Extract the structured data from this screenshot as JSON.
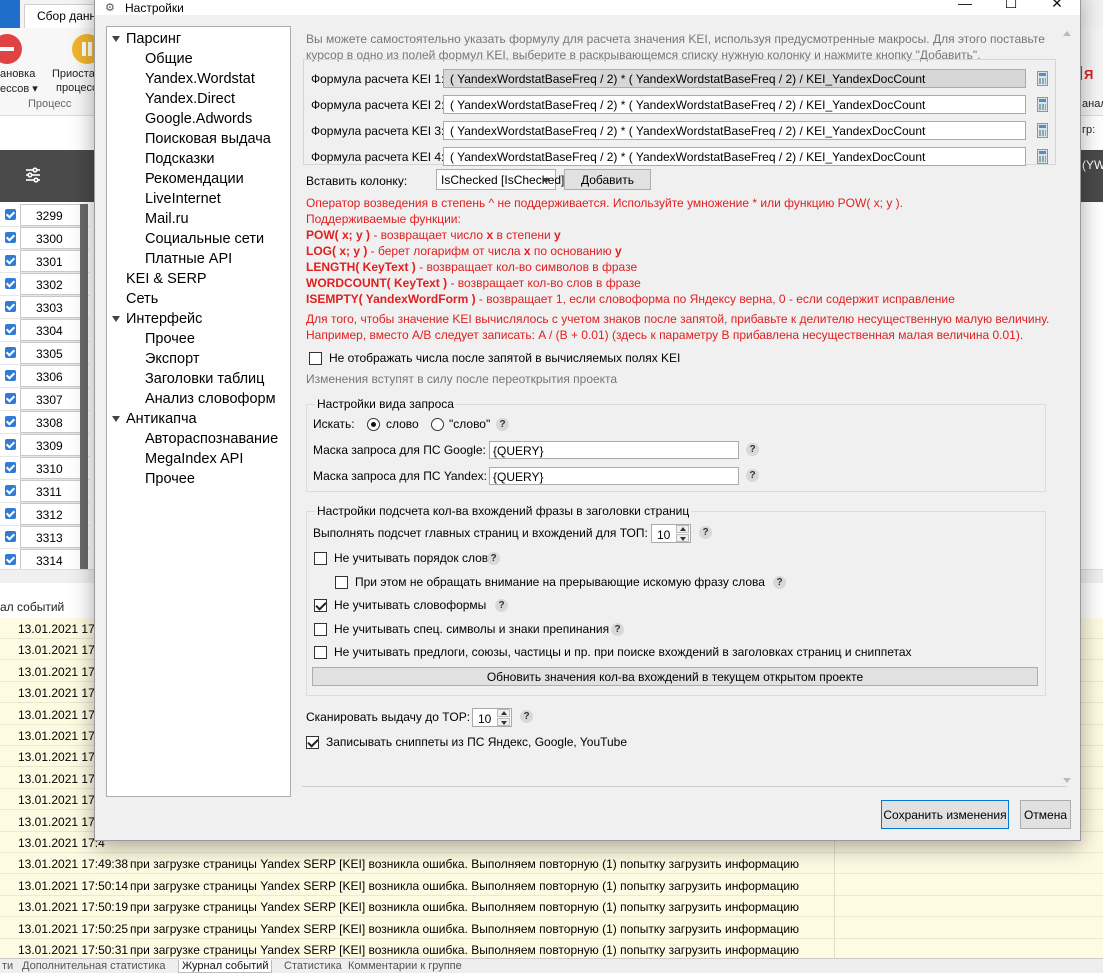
{
  "background": {
    "tab_label": "Сбор данны",
    "ribbon_labels": [
      "ановка",
      "ессов ▾",
      "Приоста",
      "процесс",
      "Процесс"
    ],
    "right_labels": [
      "Я",
      "анал",
      "гр:"
    ],
    "grid_header_right": "(YW",
    "row_numbers": [
      "3299",
      "3300",
      "3301",
      "3302",
      "3303",
      "3304",
      "3305",
      "3306",
      "3307",
      "3308",
      "3309",
      "3310",
      "3311",
      "3312",
      "3313",
      "3314"
    ],
    "log_title": "ал событий",
    "log_rows": [
      {
        "date": "13.01.2021 17:4",
        "msg": ""
      },
      {
        "date": "13.01.2021 17:4",
        "msg": ""
      },
      {
        "date": "13.01.2021 17:4",
        "msg": ""
      },
      {
        "date": "13.01.2021 17:4",
        "msg": ""
      },
      {
        "date": "13.01.2021 17:4",
        "msg": ""
      },
      {
        "date": "13.01.2021 17:4",
        "msg": ""
      },
      {
        "date": "13.01.2021 17:4",
        "msg": ""
      },
      {
        "date": "13.01.2021 17:4",
        "msg": ""
      },
      {
        "date": "13.01.2021 17:4",
        "msg": ""
      },
      {
        "date": "13.01.2021 17:4",
        "msg": ""
      },
      {
        "date": "13.01.2021 17:4",
        "msg": ""
      },
      {
        "date": "13.01.2021 17:49:38",
        "msg": "при загрузке страницы Yandex SERP [KEI] возникла ошибка. Выполняем повторную (1) попытку загрузить информацию"
      },
      {
        "date": "13.01.2021 17:50:14",
        "msg": "при загрузке страницы Yandex SERP [KEI] возникла ошибка. Выполняем повторную (1) попытку загрузить информацию"
      },
      {
        "date": "13.01.2021 17:50:19",
        "msg": "при загрузке страницы Yandex SERP [KEI] возникла ошибка. Выполняем повторную (1) попытку загрузить информацию"
      },
      {
        "date": "13.01.2021 17:50:25",
        "msg": "при загрузке страницы Yandex SERP [KEI] возникла ошибка. Выполняем повторную (1) попытку загрузить информацию"
      },
      {
        "date": "13.01.2021 17:50:31",
        "msg": "при загрузке страницы Yandex SERP [KEI] возникла ошибка. Выполняем повторную (1) попытку загрузить информацию"
      }
    ],
    "bottom_tabs": [
      "ти",
      "Дополнительная статистика",
      "Журнал событий",
      "Статистика",
      "Комментарии к группе"
    ]
  },
  "dialog": {
    "title": "Настройки",
    "title_icon": "gear-icon",
    "controls": {
      "minimize": "—",
      "maximize": "☐",
      "close": "✕"
    },
    "tree": [
      {
        "label": "Парсинг",
        "level": 0,
        "expander": true
      },
      {
        "label": "Общие",
        "level": 1
      },
      {
        "label": "Yandex.Wordstat",
        "level": 1
      },
      {
        "label": "Yandex.Direct",
        "level": 1
      },
      {
        "label": "Google.Adwords",
        "level": 1
      },
      {
        "label": "Поисковая выдача",
        "level": 1
      },
      {
        "label": "Подсказки",
        "level": 1
      },
      {
        "label": "Рекомендации",
        "level": 1
      },
      {
        "label": "LiveInternet",
        "level": 1
      },
      {
        "label": "Mail.ru",
        "level": 1
      },
      {
        "label": "Социальные сети",
        "level": 1
      },
      {
        "label": "Платные API",
        "level": 1
      },
      {
        "label": "KEI & SERP",
        "level": 0,
        "expander": false
      },
      {
        "label": "Сеть",
        "level": 0,
        "expander": false
      },
      {
        "label": "Интерфейс",
        "level": 0,
        "expander": true
      },
      {
        "label": "Прочее",
        "level": 1
      },
      {
        "label": "Экспорт",
        "level": 1
      },
      {
        "label": "Заголовки таблиц",
        "level": 1
      },
      {
        "label": "Анализ словоформ",
        "level": 1
      },
      {
        "label": "Антикапча",
        "level": 0,
        "expander": true
      },
      {
        "label": "Автораспознавание",
        "level": 1
      },
      {
        "label": "MegaIndex API",
        "level": 1
      },
      {
        "label": "Прочее",
        "level": 1
      }
    ],
    "info_text": "Вы можете самостоятельно указать формулу для расчета значения KEI, используя предусмотренные макросы. Для этого поставьте курсор в одно из полей формул KEI, выберите в раскрывающемся списку нужную колонку и нажмите кнопку \"Добавить\".",
    "formulas": [
      {
        "label": "Формула расчета KEI 1:",
        "value": "( YandexWordstatBaseFreq  / 2) * ( YandexWordstatBaseFreq  / 2) / KEI_YandexDocCount",
        "selected": true
      },
      {
        "label": "Формула расчета KEI 2:",
        "value": "( YandexWordstatBaseFreq  / 2) * ( YandexWordstatBaseFreq  / 2) / KEI_YandexDocCount",
        "selected": false
      },
      {
        "label": "Формула расчета KEI 3:",
        "value": "( YandexWordstatBaseFreq  / 2) * ( YandexWordstatBaseFreq  / 2) / KEI_YandexDocCount",
        "selected": false
      },
      {
        "label": "Формула расчета KEI 4:",
        "value": "( YandexWordstatBaseFreq  / 2) * ( YandexWordstatBaseFreq  / 2) / KEI_YandexDocCount",
        "selected": false
      }
    ],
    "insert_label": "Вставить колонку:",
    "insert_value": "IsChecked [IsChecked]",
    "add_button": "Добавить",
    "notes": {
      "power": "Оператор возведения в степень ^ не поддерживается. Используйте умножение * или функцию POW( x; y ).",
      "supported": "Поддерживаемые функции:",
      "functions": [
        {
          "name": "POW( x; y )",
          "desc_parts": [
            "  - возвращает число ",
            "x",
            " в степени ",
            "y"
          ]
        },
        {
          "name": "LOG( x; y )",
          "desc_parts": [
            "  - берет логарифм от числа ",
            "x",
            " по основанию ",
            "y"
          ]
        },
        {
          "name": "LENGTH( KeyText )",
          "desc_parts": [
            "  - возвращает кол-во символов в фразе"
          ]
        },
        {
          "name": "WORDCOUNT( KeyText )",
          "desc_parts": [
            "  - возвращает кол-во слов в фразе"
          ]
        },
        {
          "name": "ISEMPTY( YandexWordForm )",
          "desc_parts": [
            "  - возвращает 1, если словоформа по Яндексу верна, 0 - если содержит исправление"
          ]
        }
      ],
      "comma_1": "Для того, чтобы значение KEI вычислялось с учетом знаков после запятой, прибавьте к делителю несущественную малую величину.",
      "comma_2": "Например, вместо A/B следует записать: A / (B + 0.01) (здесь к параметру B прибавлена несущественная малая величина 0.01)."
    },
    "hide_decimals": {
      "label": "Не отображать числа после запятой в вычисляемых полях KEI",
      "checked": false
    },
    "restart_note": "Изменения вступят в силу после переоткрытия проекта",
    "query_group": {
      "legend": "Настройки вида запроса",
      "search_label": "Искать:",
      "radio_word": "слово",
      "radio_quoted": "\"слово\"",
      "radio_selected": "word",
      "google_label": "Маска запроса для ПС Google:",
      "google_value": "{QUERY}",
      "yandex_label": "Маска запроса для ПС Yandex:",
      "yandex_value": "{QUERY}"
    },
    "count_group": {
      "legend": "Настройки подсчета кол-ва вхождений фразы в заголовки страниц",
      "top_label": "Выполнять подсчет главных страниц и вхождений для ТОП:",
      "top_value": "10",
      "options": [
        {
          "label": "Не учитывать порядок слов",
          "checked": false,
          "indent": false
        },
        {
          "label": "При этом не обращать внимание на прерывающие искомую фразу слова",
          "checked": false,
          "indent": true
        },
        {
          "label": "Не учитывать словоформы",
          "checked": true,
          "indent": false
        },
        {
          "label": "Не учитывать спец. символы и знаки препинания",
          "checked": false,
          "indent": false
        },
        {
          "label": "Не учитывать предлоги, союзы, частицы и пр. при поиске вхождений в заголовках страниц и сниппетах",
          "checked": false,
          "indent": false
        }
      ],
      "update_button": "Обновить значения кол-ва вхождений в текущем открытом проекте"
    },
    "scan_label": "Сканировать выдачу до TOP:",
    "scan_value": "10",
    "snippets": {
      "label": "Записывать сниппеты из ПС Яндекс, Google, YouTube",
      "checked": true
    },
    "save_button": "Сохранить изменения",
    "cancel_button": "Отмена"
  }
}
